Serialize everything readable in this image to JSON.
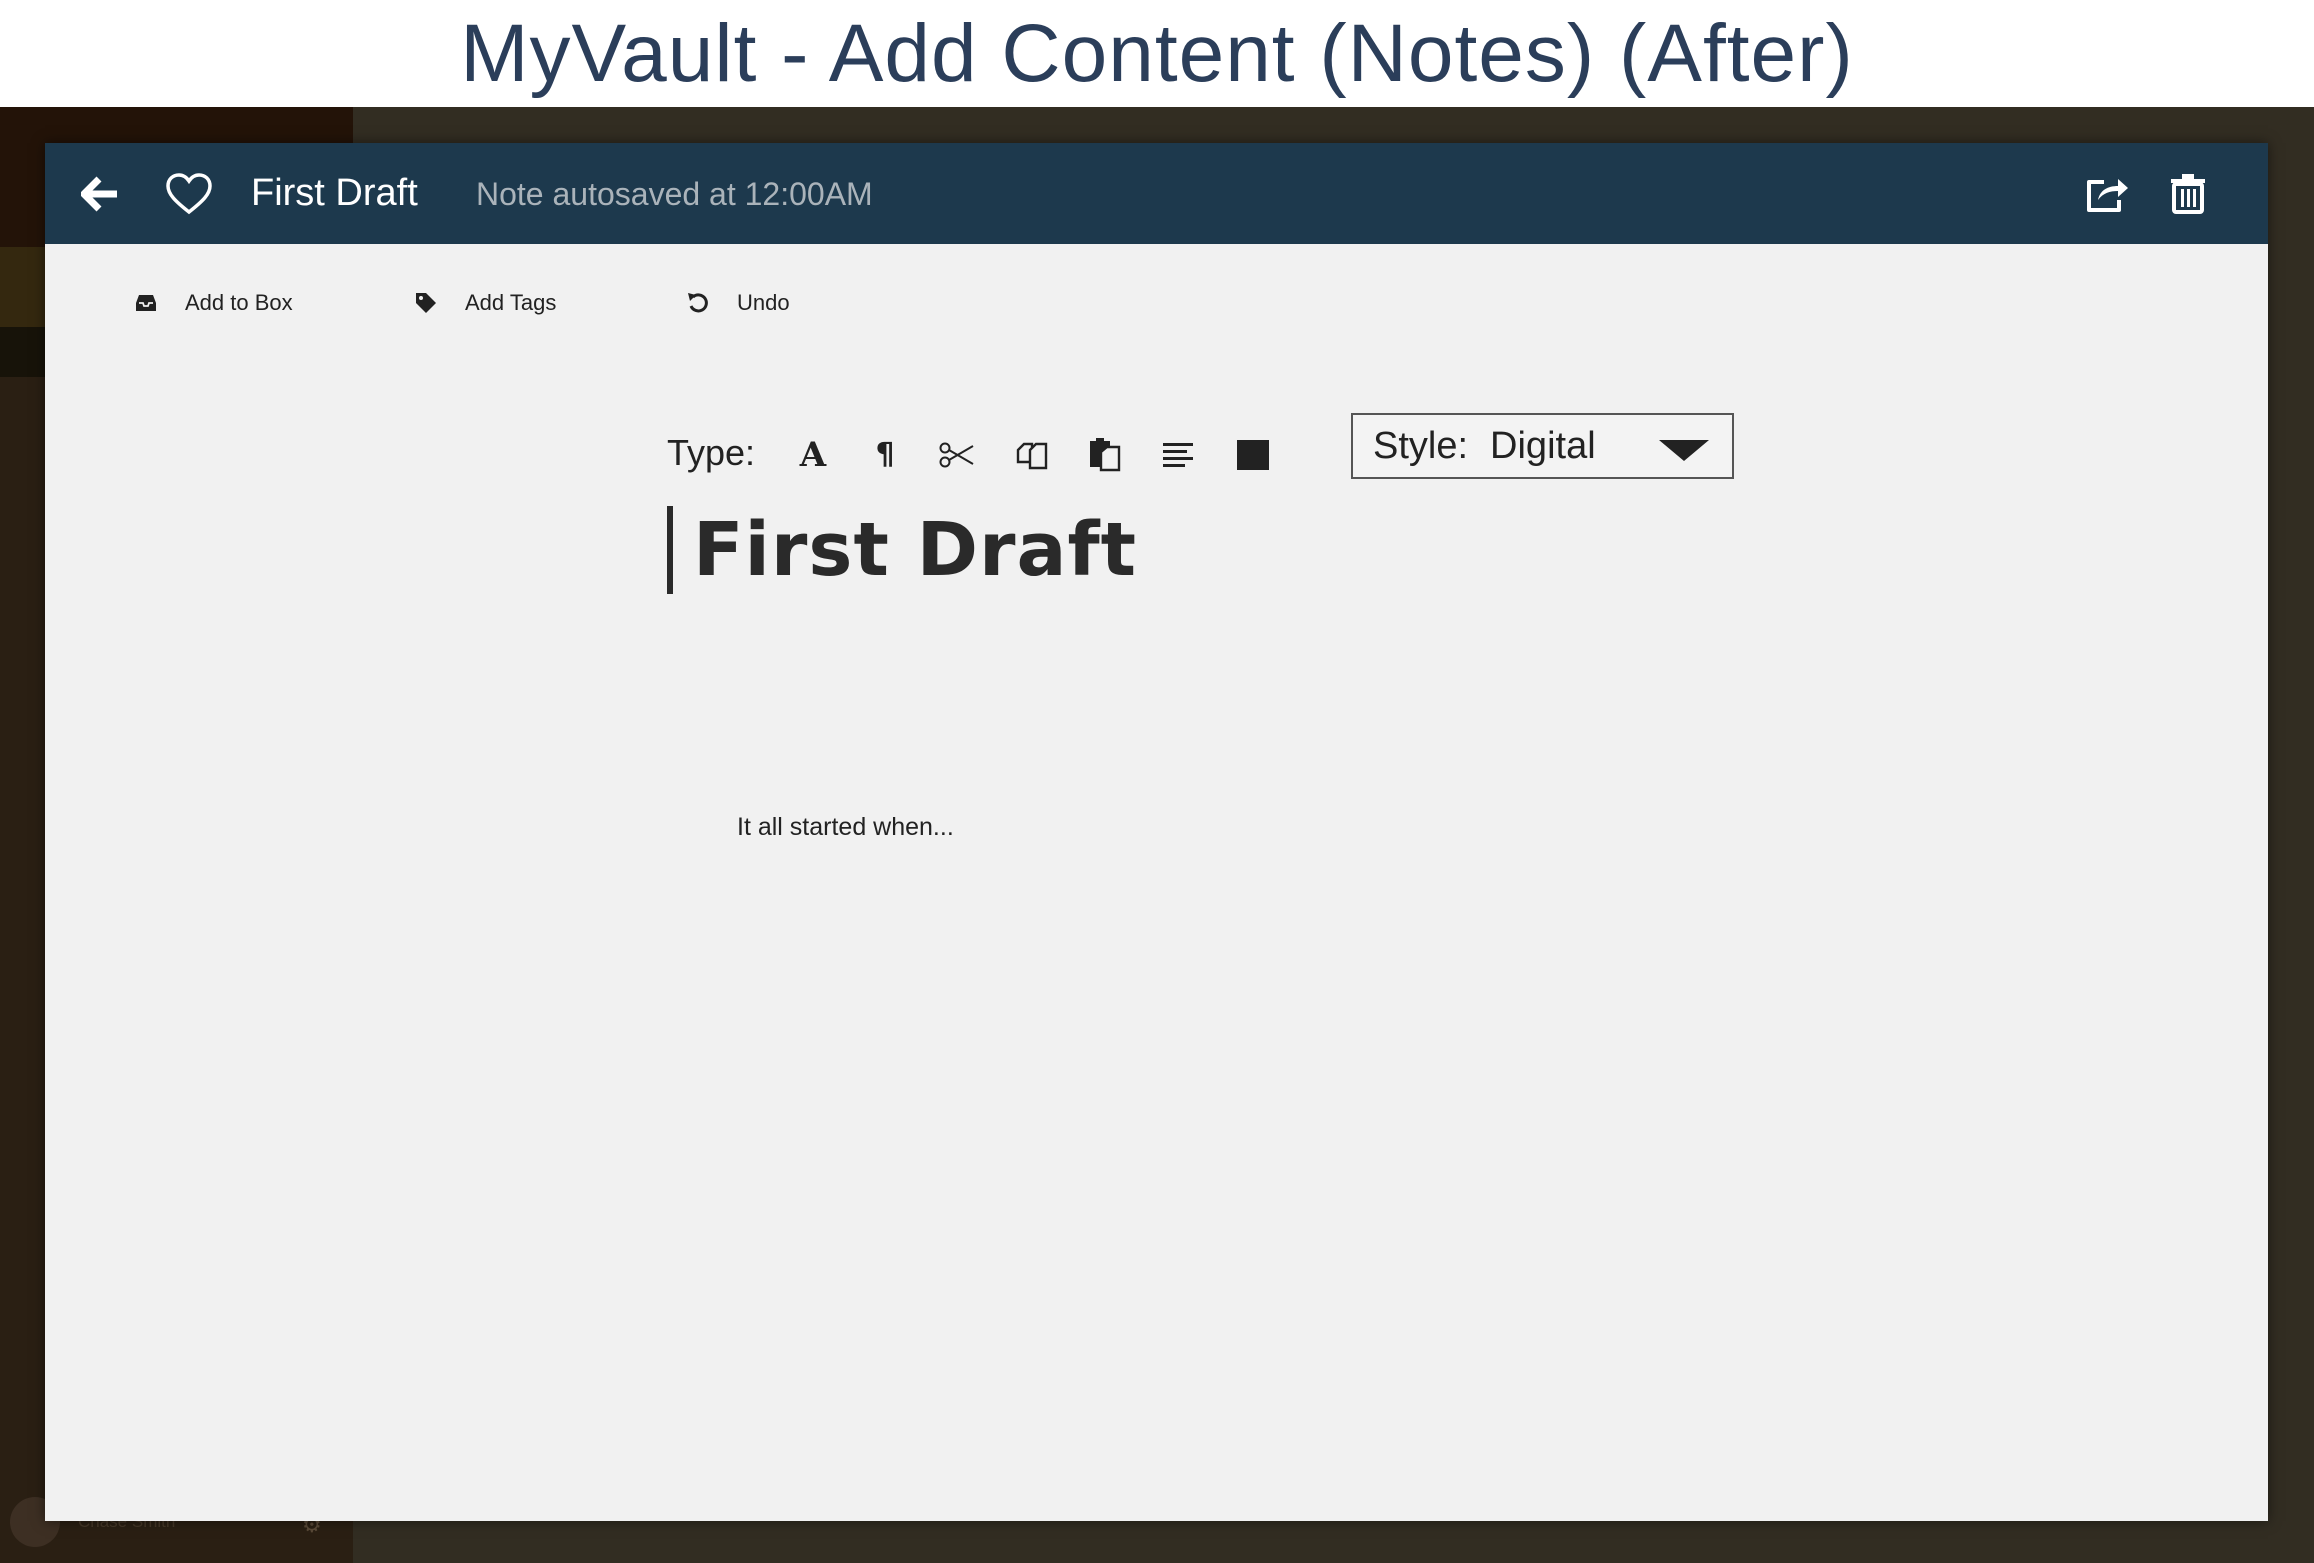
{
  "slide": {
    "title": "MyVault - Add Content (Notes) (After)"
  },
  "background_app": {
    "user_name": "Chase Smith"
  },
  "topbar": {
    "note_title": "First Draft",
    "status": "Note autosaved at 12:00AM",
    "icons": [
      "back-arrow-icon",
      "heart-icon",
      "share-icon",
      "trash-icon"
    ]
  },
  "actions": [
    {
      "label": "Add to Box",
      "icon": "inbox-icon"
    },
    {
      "label": "Add Tags",
      "icon": "tag-icon"
    },
    {
      "label": "Undo",
      "icon": "undo-icon"
    }
  ],
  "formatting": {
    "type_label": "Type:",
    "tools": [
      "font-icon",
      "paragraph-icon",
      "cut-icon",
      "copy-icon",
      "paste-icon",
      "align-left-icon",
      "color-swatch-icon"
    ],
    "style_label": "Style:",
    "style_value": "Digital"
  },
  "document": {
    "title": "First Draft",
    "body": "It all started when..."
  },
  "colors": {
    "topbar": "#1d394d",
    "editor_bg": "#f1f1f1",
    "slide_title": "#2b3e5a",
    "backdrop": "#322d22"
  }
}
